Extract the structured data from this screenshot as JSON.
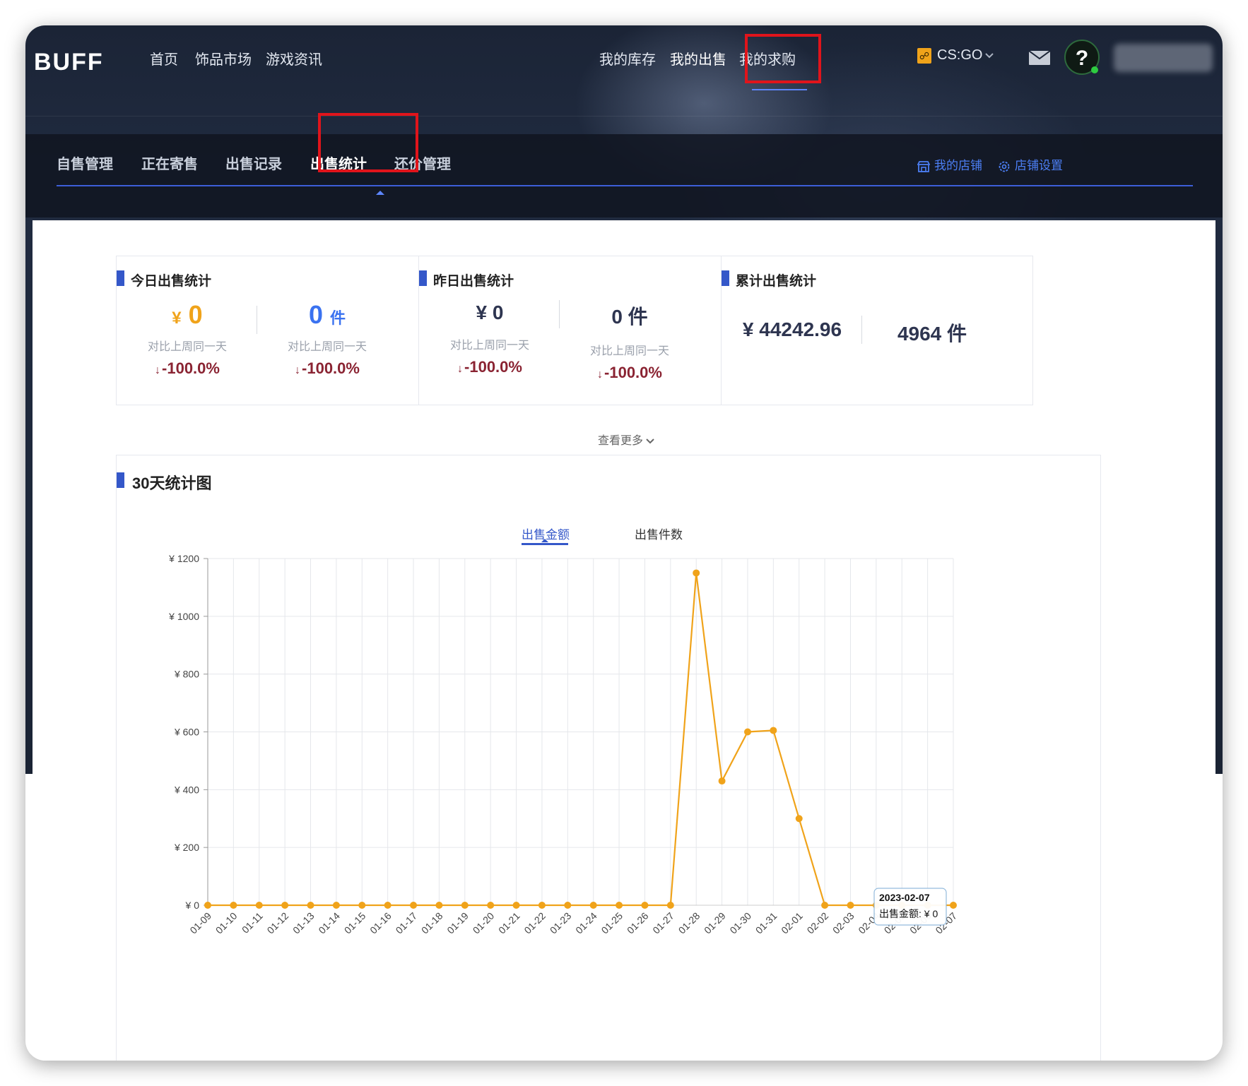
{
  "topnav": {
    "logo": "BUFF",
    "left_items": [
      "首页",
      "饰品市场",
      "游戏资讯"
    ],
    "right_items": [
      "我的库存",
      "我的出售",
      "我的求购"
    ],
    "game": "CS:GO",
    "help": "?"
  },
  "subnav": {
    "tabs": [
      "自售管理",
      "正在寄售",
      "出售记录",
      "出售统计",
      "还价管理"
    ],
    "links": [
      "我的店铺",
      "店铺设置"
    ]
  },
  "cards": {
    "today": {
      "title": "今日出售统计",
      "amount": "0",
      "amount_prefix": "¥",
      "count": "0",
      "count_suffix": "件",
      "compare_label": "对比上周同一天",
      "amount_change": "-100.0%",
      "count_change": "-100.0%"
    },
    "yesterday": {
      "title": "昨日出售统计",
      "amount": "¥ 0",
      "count": "0 件",
      "compare_label": "对比上周同一天",
      "amount_change": "-100.0%",
      "count_change": "-100.0%"
    },
    "total": {
      "title": "累计出售统计",
      "amount": "¥ 44242.96",
      "count": "4964 件"
    }
  },
  "see_more": "查看更多",
  "chart_section": {
    "title": "30天统计图",
    "tabs": [
      "出售金额",
      "出售件数"
    ],
    "tooltip": {
      "date": "2023-02-07",
      "label": "出售金额: ¥ 0"
    }
  },
  "colors": {
    "accent_blue": "#3457c9",
    "line_orange": "#f0a31a",
    "highlight_red": "#e0141b",
    "change_red": "#8a2332",
    "today_amount": "#f0a31a",
    "today_count": "#3a72f0"
  },
  "chart_data": {
    "type": "line",
    "x": [
      "01-09",
      "01-10",
      "01-11",
      "01-12",
      "01-13",
      "01-14",
      "01-15",
      "01-16",
      "01-17",
      "01-18",
      "01-19",
      "01-20",
      "01-21",
      "01-22",
      "01-23",
      "01-24",
      "01-25",
      "01-26",
      "01-27",
      "01-28",
      "01-29",
      "01-30",
      "01-31",
      "02-01",
      "02-02",
      "02-03",
      "02-04",
      "02-05",
      "02-06",
      "02-07"
    ],
    "series": [
      {
        "values": [
          0,
          0,
          0,
          0,
          0,
          0,
          0,
          0,
          0,
          0,
          0,
          0,
          0,
          0,
          0,
          0,
          0,
          0,
          0,
          1150,
          430,
          600,
          605,
          300,
          0,
          0,
          0,
          0,
          0,
          0
        ]
      }
    ],
    "yticks": [
      "¥ 0",
      "¥ 200",
      "¥ 400",
      "¥ 600",
      "¥ 800",
      "¥ 1000",
      "¥ 1200"
    ],
    "ylim": [
      0,
      1200
    ],
    "grid": true
  }
}
